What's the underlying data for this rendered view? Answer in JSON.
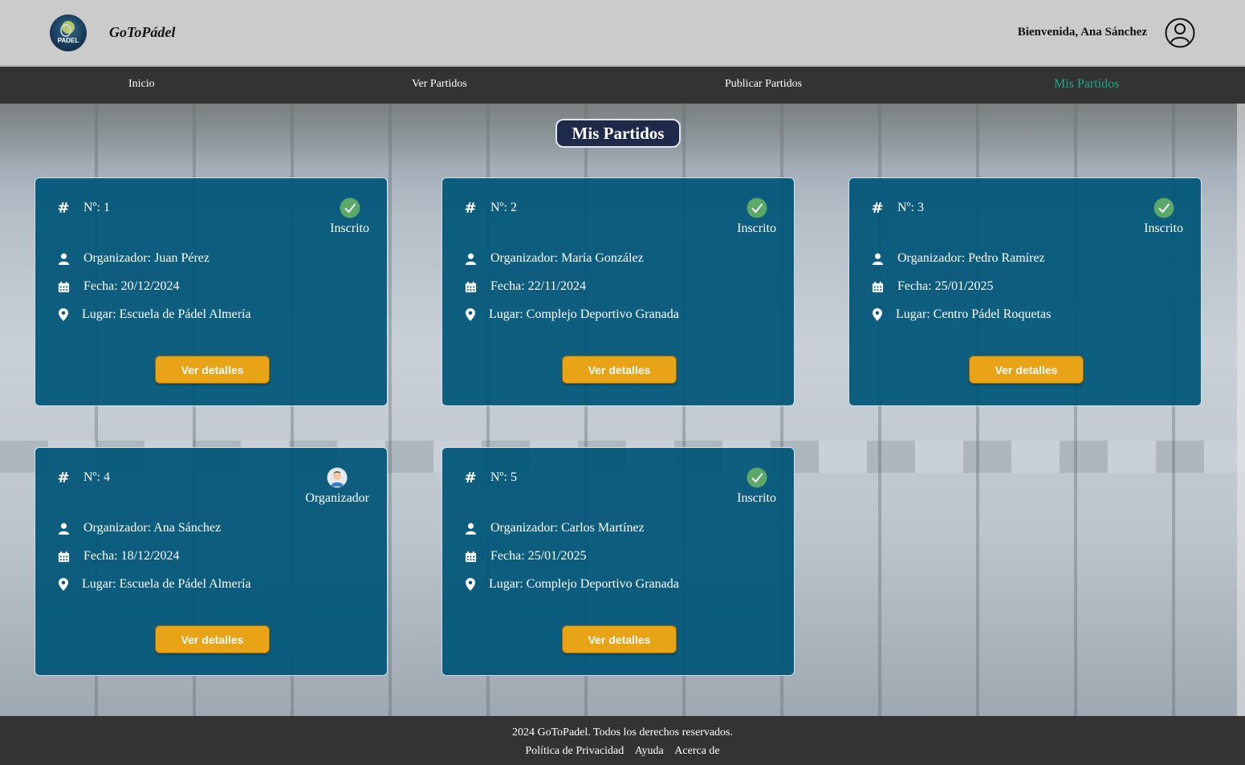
{
  "header": {
    "brand": "GoToPádel",
    "logo_text": "PADEL",
    "welcome": "Bienvenida, Ana Sánchez"
  },
  "nav": {
    "items": [
      {
        "label": "Inicio"
      },
      {
        "label": "Ver Partidos"
      },
      {
        "label": "Publicar Partidos"
      },
      {
        "label": "Mis Partidos",
        "active": true
      }
    ],
    "active_color": "#1fa88a"
  },
  "main": {
    "title": "Mis Partidos",
    "cards": [
      {
        "number": "Nº: 1",
        "status": "Inscrito",
        "status_icon": "check-icon",
        "organizer": "Organizador: Juan Pérez",
        "date": "Fecha: 20/12/2024",
        "place": "Lugar: Escuela de Pádel Almería",
        "button": "Ver detalles"
      },
      {
        "number": "Nº: 2",
        "status": "Inscrito",
        "status_icon": "check-icon",
        "organizer": "Organizador: María González",
        "date": "Fecha: 22/11/2024",
        "place": "Lugar: Complejo Deportivo Granada",
        "button": "Ver detalles"
      },
      {
        "number": "Nº: 3",
        "status": "Inscrito",
        "status_icon": "check-icon",
        "organizer": "Organizador: Pedro Ramírez",
        "date": "Fecha: 25/01/2025",
        "place": "Lugar: Centro Pádel Roquetas",
        "button": "Ver detalles"
      },
      {
        "number": "Nº: 4",
        "status": "Organizador",
        "status_icon": "organizer-avatar-icon",
        "organizer": "Organizador: Ana Sánchez",
        "date": "Fecha: 18/12/2024",
        "place": "Lugar: Escuela de Pádel Almería",
        "button": "Ver detalles"
      },
      {
        "number": "Nº: 5",
        "status": "Inscrito",
        "status_icon": "check-icon",
        "organizer": "Organizador: Carlos Martínez",
        "date": "Fecha: 25/01/2025",
        "place": "Lugar: Complejo Deportivo Granada",
        "button": "Ver detalles"
      }
    ]
  },
  "footer": {
    "copyright": "2024 GoToPadel. Todos los derechos reservados.",
    "links": [
      "Política de Privacidad",
      "Ayuda",
      "Acerca de"
    ]
  },
  "colors": {
    "card_bg": "#005578",
    "button_bg": "#e8a317",
    "nav_bg": "#333333",
    "title_bg": "#1f2a4a",
    "check_green": "#5aa86a"
  }
}
